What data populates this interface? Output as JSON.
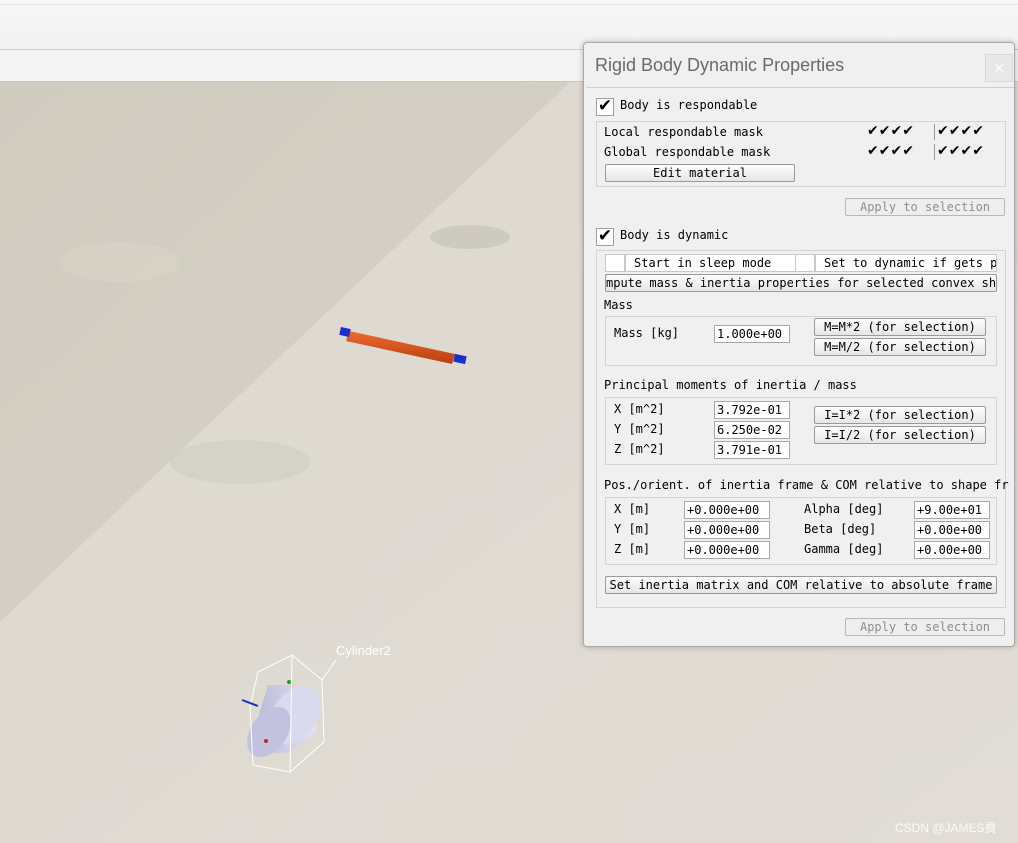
{
  "scene": {
    "object_label": "Cylinder2",
    "watermark": "CSDN @JAMES费"
  },
  "dialog": {
    "title": "Rigid Body Dynamic Properties",
    "close_symbol": "×",
    "respondable": {
      "checkbox_label": "Body is respondable",
      "checked": true,
      "local_mask_label": "Local respondable mask",
      "global_mask_label": "Global respondable mask",
      "local_mask_a": "✔✔✔✔",
      "local_mask_b": "✔✔✔✔",
      "global_mask_a": "✔✔✔✔",
      "global_mask_b": "✔✔✔✔",
      "edit_material_label": "Edit material",
      "apply_label": "Apply to selection"
    },
    "dynamic": {
      "checkbox_label": "Body is dynamic",
      "checked": true,
      "sleep_mode_label": "Start in sleep mode",
      "set_dynamic_label": "Set to dynamic if gets par",
      "compute_label": "mpute mass & inertia properties for selected convex shap",
      "mass_section_label": "Mass",
      "mass_label": "Mass [kg]",
      "mass_value": "1.000e+00",
      "mass_times2_label": "M=M*2  (for selection)",
      "mass_div2_label": "M=M/2  (for selection)",
      "inertia_section_label": "Principal moments of inertia / mass",
      "inertia_x_label": "X [m^2]",
      "inertia_y_label": "Y [m^2]",
      "inertia_z_label": "Z [m^2]",
      "inertia_x_value": "3.792e-01",
      "inertia_y_value": "6.250e-02",
      "inertia_z_value": "3.791e-01",
      "inertia_times2_label": "I=I*2  (for selection)",
      "inertia_div2_label": "I=I/2  (for selection)",
      "pos_section_label": "Pos./orient. of inertia frame & COM relative to shape fr",
      "pos_x_label": "X [m]",
      "pos_y_label": "Y [m]",
      "pos_z_label": "Z [m]",
      "pos_x_value": "+0.000e+00",
      "pos_y_value": "+0.000e+00",
      "pos_z_value": "+0.000e+00",
      "alpha_label": "Alpha [deg]",
      "beta_label": "Beta [deg]",
      "gamma_label": "Gamma [deg]",
      "alpha_value": "+9.00e+01",
      "beta_value": "+0.00e+00",
      "gamma_value": "+0.00e+00",
      "set_inertia_label": "Set inertia matrix and COM relative to absolute frame",
      "apply_label": "Apply to selection"
    }
  },
  "colors": {
    "rod": "#e0521c",
    "rod_cap": "#1a2fd0",
    "cylinder": "#c9c9e4"
  }
}
